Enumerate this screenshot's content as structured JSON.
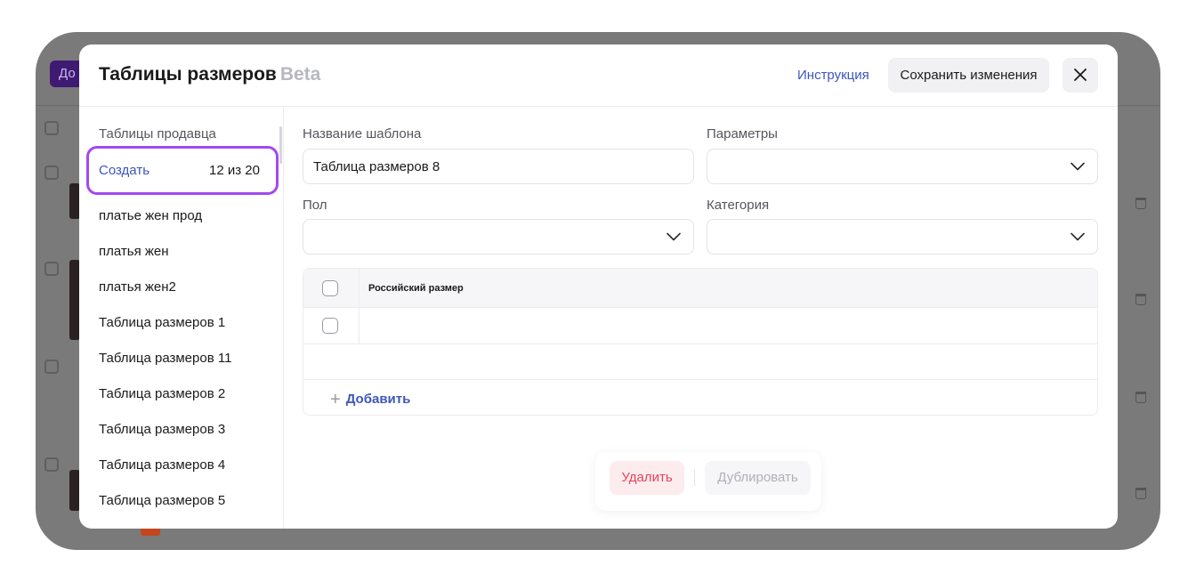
{
  "background": {
    "button_label": "До"
  },
  "modal": {
    "title": "Таблицы размеров",
    "title_badge": "Beta",
    "instructions_link": "Инструкция",
    "save_button": "Сохранить изменения",
    "close_icon": "close-icon"
  },
  "sidebar": {
    "heading": "Таблицы продавца",
    "create_label": "Создать",
    "create_count": "12 из 20",
    "items": [
      "платье жен прод",
      "платья жен",
      "платья жен2",
      "Таблица размеров 1",
      "Таблица размеров 11",
      "Таблица размеров 2",
      "Таблица размеров 3",
      "Таблица размеров 4",
      "Таблица размеров 5"
    ]
  },
  "form": {
    "template_name_label": "Название шаблона",
    "template_name_value": "Таблица размеров 8",
    "parameters_label": "Параметры",
    "parameters_value": "",
    "gender_label": "Пол",
    "gender_value": "",
    "category_label": "Категория",
    "category_value": ""
  },
  "table": {
    "columns": [
      "Российский размер"
    ],
    "rows": [
      [
        ""
      ]
    ],
    "add_label": "Добавить"
  },
  "actions": {
    "delete": "Удалить",
    "duplicate": "Дублировать"
  },
  "colors": {
    "accent_link": "#3d56b9",
    "highlight_outline": "#a349f0",
    "delete_text": "#e5455a",
    "overlay": "#7a7a7a"
  }
}
